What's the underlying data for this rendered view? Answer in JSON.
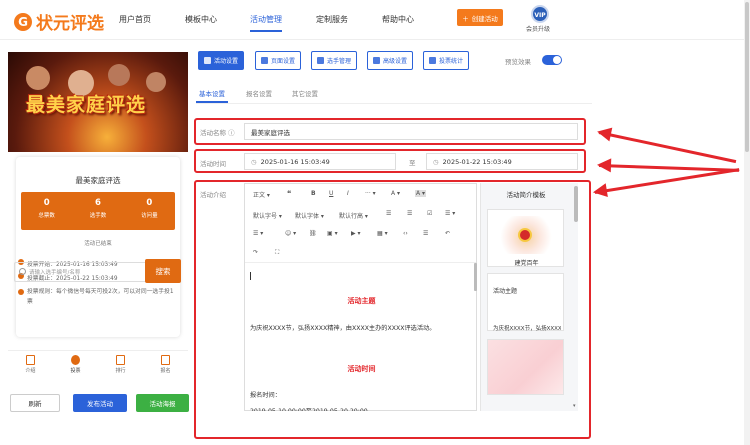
{
  "header": {
    "logo_mark": "G",
    "logo_text": "状元评选",
    "nav": [
      "用户首页",
      "模板中心",
      "活动管理",
      "定制服务",
      "帮助中心"
    ],
    "active_nav": "活动管理",
    "create_btn": "创建活动",
    "vip_badge": "VIP",
    "vip_label": "会员升级"
  },
  "phone": {
    "hero_title": "最美家庭评选",
    "card_title": "最美家庭评选",
    "stats": [
      {
        "num": "0",
        "label": "总票数"
      },
      {
        "num": "6",
        "label": "选手数"
      },
      {
        "num": "0",
        "label": "访问量"
      }
    ],
    "status": "活动已结束",
    "vote_start": "投票开始：2025-01-16 15:03:49",
    "vote_end": "投票截止：2025-01-22 15:03:49",
    "rule": "投票规则：每个微信号每天可投2次，可以对同一选手投1票",
    "search_placeholder": "请输入选手编号/名称",
    "search_btn": "搜索",
    "tabs": [
      "介绍",
      "投票",
      "排行",
      "报名"
    ]
  },
  "bottom_buttons": {
    "refresh": "刷新",
    "publish": "发布活动",
    "poster": "活动海报"
  },
  "toolbar": {
    "buttons": [
      "活动设置",
      "页面设置",
      "选手管理",
      "高级设置",
      "投票统计"
    ],
    "preview_label": "预览效果"
  },
  "subtabs": [
    "基本设置",
    "报名设置",
    "其它设置"
  ],
  "form": {
    "name_label": "活动名称",
    "name_value": "最美家庭评选",
    "time_label": "活动时间",
    "start_time": "2025-01-16 15:03:49",
    "to": "至",
    "end_time": "2025-01-22 15:03:49",
    "intro_label": "活动介绍"
  },
  "editor": {
    "toolbar_row1": [
      "正文",
      "❝",
      "B",
      "U",
      "I",
      "···",
      "A",
      "A"
    ],
    "toolbar_row2": [
      "默认字号",
      "默认字体",
      "默认行高",
      "☰",
      "☰",
      "☑",
      "☰"
    ],
    "toolbar_row3": [
      "☰",
      "☺",
      "⛓",
      "▣",
      "▶",
      "▦",
      "‹›",
      "☰",
      "↶"
    ],
    "toolbar_row4": [
      "↷",
      "⛶"
    ],
    "heading1": "活动主题",
    "para1": "为庆祝XXXX节，弘扬XXXX精神，由XXXX主办的XXXX评选活动。",
    "heading2": "活动时间",
    "para2": "报名时间：",
    "para3": "2019-05-10 00:00至2019-05-20 20:00"
  },
  "templates": {
    "title": "活动简介模板",
    "card1_caption": "建党百年",
    "card2_caption": "活动主题",
    "card2_text": "为庆祝XXXX节，弘扬XXXX"
  }
}
